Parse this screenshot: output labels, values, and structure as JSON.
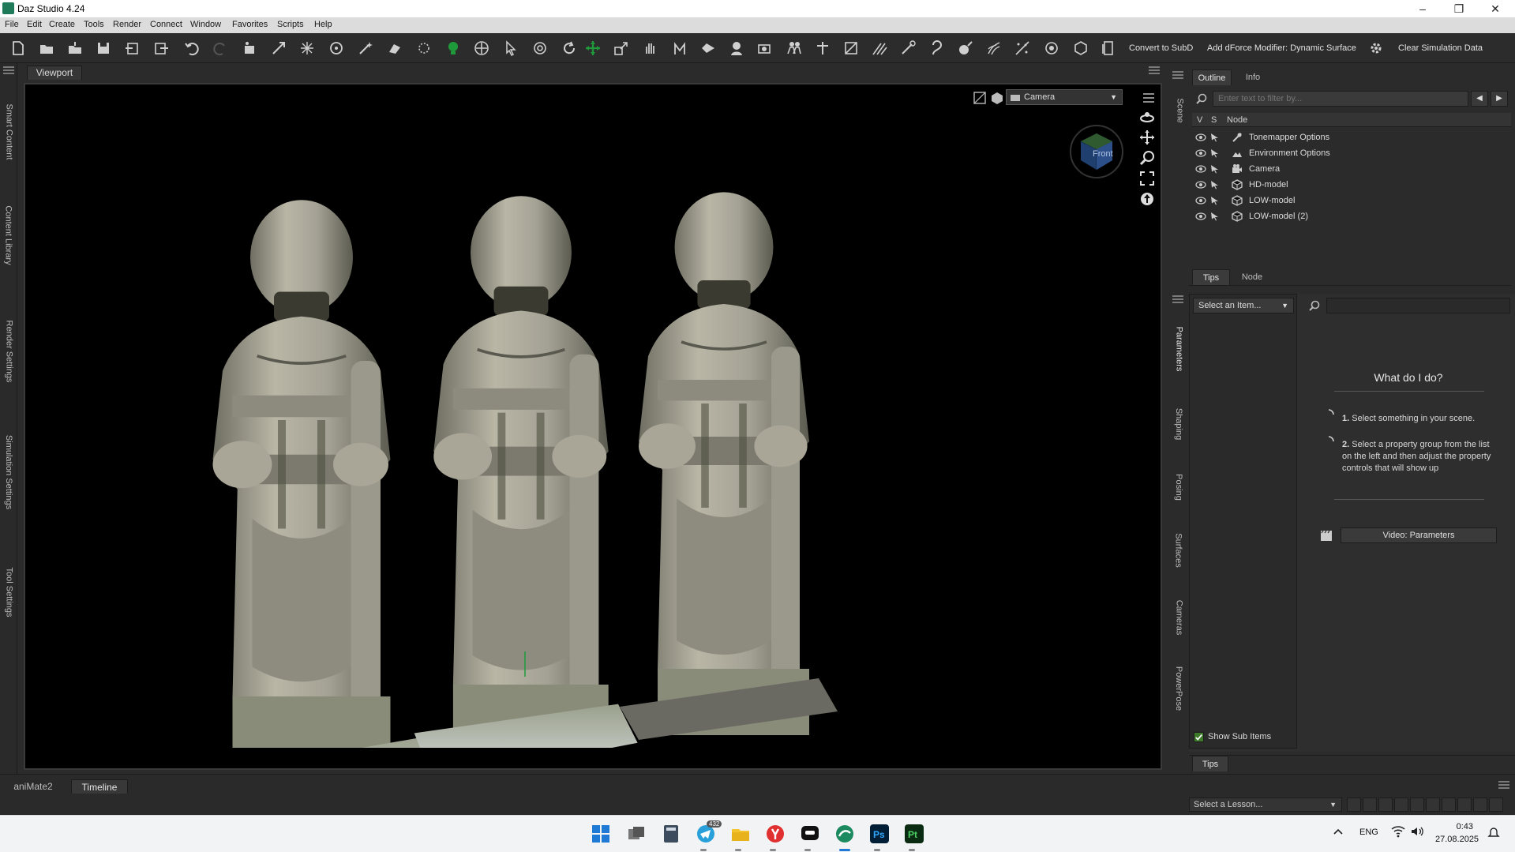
{
  "window": {
    "title": "Daz Studio 4.24"
  },
  "menu": [
    "File",
    "Edit",
    "Create",
    "Tools",
    "Render",
    "Connect",
    "Window",
    "Favorites",
    "Scripts",
    "Help"
  ],
  "toolbar": {
    "convert_subd": "Convert to SubD",
    "add_dforce": "Add dForce Modifier: Dynamic Surface",
    "clear_sim": "Clear Simulation Data"
  },
  "left_tabs": [
    "Smart Content",
    "Content Library",
    "Render Settings",
    "Simulation Settings",
    "Tool Settings"
  ],
  "viewport": {
    "tab_label": "Viewport",
    "camera": "Camera",
    "navcube_face": "Front"
  },
  "scene": {
    "side_tab": "Scene",
    "tabs": [
      "Outline",
      "Info"
    ],
    "filter_placeholder": "Enter text to filter by...",
    "columns": {
      "v": "V",
      "s": "S",
      "node": "Node"
    },
    "nodes": [
      {
        "label": "Tonemapper Options",
        "icon": "tonemapper-icon"
      },
      {
        "label": "Environment Options",
        "icon": "environment-icon"
      },
      {
        "label": "Camera",
        "icon": "camera-icon"
      },
      {
        "label": "HD-model",
        "icon": "object-icon"
      },
      {
        "label": "LOW-model",
        "icon": "object-icon"
      },
      {
        "label": "LOW-model (2)",
        "icon": "object-icon"
      }
    ],
    "bottom_tabs": [
      "Tips",
      "Node"
    ]
  },
  "parameters": {
    "side_tabs": [
      "Parameters",
      "Shaping",
      "Posing",
      "Surfaces",
      "Cameras",
      "PowerPose"
    ],
    "select_item": "Select an Item...",
    "help_title": "What do I do?",
    "steps": [
      {
        "num": "1.",
        "text": "Select something in your scene."
      },
      {
        "num": "2.",
        "text": "Select a property group from the list on the left and then adjust the property controls that will show up"
      }
    ],
    "video_button": "Video: Parameters",
    "show_sub_items": "Show Sub Items",
    "bottom_tab": "Tips"
  },
  "bottom": {
    "tabs": [
      "aniMate2",
      "Timeline"
    ],
    "lesson_select": "Select a Lesson..."
  },
  "taskbar": {
    "lang": "ENG",
    "time": "0:43",
    "date": "27.08.2025",
    "telegram_badge": "432"
  },
  "colors": {
    "accent_green": "#1f9a3a",
    "panel_bg": "#2e2e2e",
    "viewport_bg": "#000000"
  }
}
